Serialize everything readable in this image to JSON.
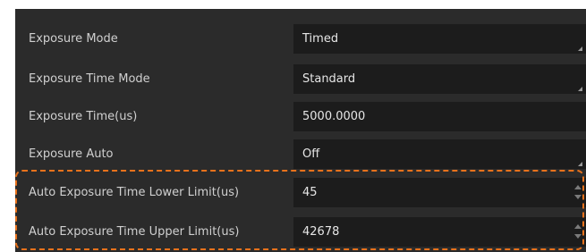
{
  "properties": [
    {
      "label": "Exposure Mode",
      "value": "Timed",
      "control": "dropdown"
    },
    {
      "label": "Exposure Time Mode",
      "value": "Standard",
      "control": "dropdown"
    },
    {
      "label": "Exposure Time(us)",
      "value": "5000.0000",
      "control": "text"
    },
    {
      "label": "Exposure Auto",
      "value": "Off",
      "control": "dropdown"
    },
    {
      "label": "Auto Exposure Time Lower Limit(us)",
      "value": "45",
      "control": "spinbox"
    },
    {
      "label": "Auto Exposure Time Upper Limit(us)",
      "value": "42678",
      "control": "spinbox"
    }
  ],
  "colors": {
    "panel_bg": "#2b2b2b",
    "value_bg": "#1c1c1c",
    "highlight": "#e8721c"
  }
}
